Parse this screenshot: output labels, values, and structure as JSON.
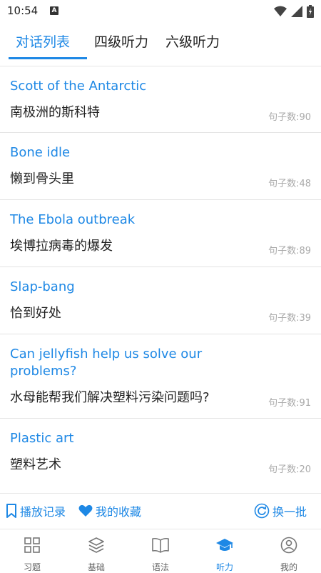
{
  "status_bar": {
    "time": "10:54",
    "badge": "A"
  },
  "tabs": [
    {
      "label": "对话列表",
      "active": true
    },
    {
      "label": "四级听力",
      "active": false
    },
    {
      "label": "六级听力",
      "active": false
    }
  ],
  "dialogs": [
    {
      "title": "Scott of the Antarctic",
      "subtitle": "南极洲的斯科特",
      "count": "句子数:90"
    },
    {
      "title": "Bone idle",
      "subtitle": "懒到骨头里",
      "count": "句子数:48"
    },
    {
      "title": "The Ebola outbreak",
      "subtitle": "埃博拉病毒的爆发",
      "count": "句子数:89"
    },
    {
      "title": "Slap-bang",
      "subtitle": "恰到好处",
      "count": "句子数:39"
    },
    {
      "title": "Can jellyfish help us solve our problems?",
      "subtitle": "水母能帮我们解决塑料污染问题吗?",
      "count": "句子数:91"
    },
    {
      "title": "Plastic art",
      "subtitle": "塑料艺术",
      "count": "句子数:20"
    }
  ],
  "actions": {
    "history": "播放记录",
    "favorites": "我的收藏",
    "refresh": "换一批"
  },
  "nav": [
    {
      "label": "习题",
      "icon": "grid-icon",
      "active": false
    },
    {
      "label": "基础",
      "icon": "layers-icon",
      "active": false
    },
    {
      "label": "语法",
      "icon": "book-icon",
      "active": false
    },
    {
      "label": "听力",
      "icon": "graduation-cap-icon",
      "active": true
    },
    {
      "label": "我的",
      "icon": "user-icon",
      "active": false
    }
  ],
  "colors": {
    "accent": "#1e88e5",
    "muted": "#aaaaaa"
  }
}
